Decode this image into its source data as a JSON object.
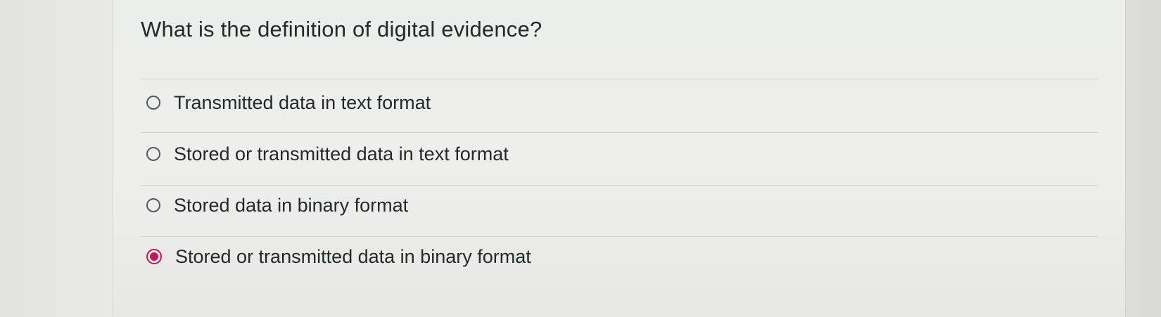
{
  "question": {
    "text": "What is the definition of digital evidence?"
  },
  "options": [
    {
      "label": "Transmitted data in text format",
      "selected": false
    },
    {
      "label": "Stored or transmitted data in text format",
      "selected": false
    },
    {
      "label": "Stored data in binary format",
      "selected": false
    },
    {
      "label": "Stored or transmitted data in binary format",
      "selected": true
    }
  ],
  "colors": {
    "accent": "#c2185b",
    "text": "#26292b",
    "radio_border": "#555a5e"
  }
}
